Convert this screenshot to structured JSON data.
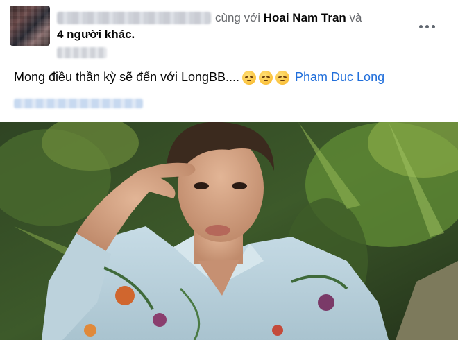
{
  "post": {
    "with_text": "cùng với",
    "tagged_friend": "Hoai Nam Tran",
    "and_text": "và",
    "others": "4 người khác.",
    "caption": "Mong điều thần kỳ sẽ đến với LongBB....",
    "emoji_icon": "sad-face-emoji",
    "mention": "Pham Duc Long"
  },
  "colors": {
    "link_blue": "#216fdb",
    "secondary_text": "#65676b"
  }
}
